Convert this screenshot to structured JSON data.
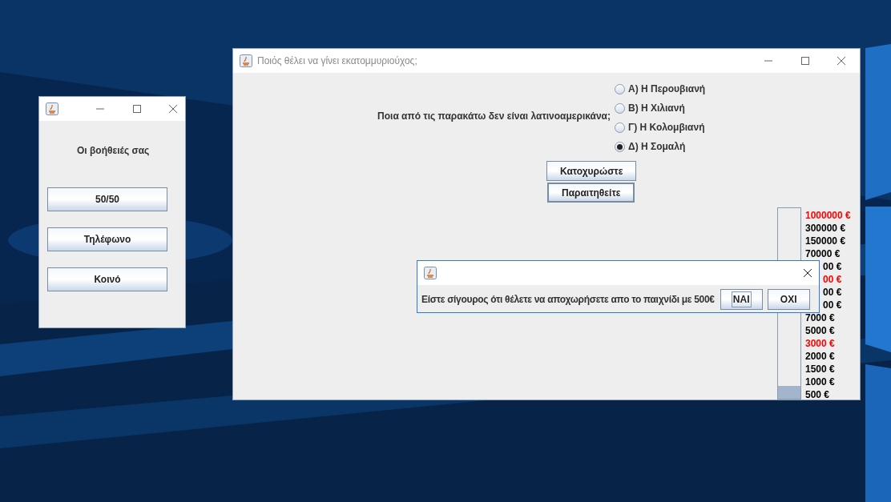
{
  "helpers_window": {
    "heading": "Οι βοήθειές σας",
    "buttons": [
      "50/50",
      "Τηλέφωνο",
      "Κοινό"
    ]
  },
  "main_window": {
    "title": "Ποιός θέλει να γίνει εκατομμυριούχος;",
    "question": "Ποια από τις παρακάτω δεν είναι λατινοαμερικάνα;",
    "answers": [
      {
        "label": "Α) Η Περουβιανή",
        "selected": false
      },
      {
        "label": "Β) Η Χιλιανή",
        "selected": false
      },
      {
        "label": "Γ) Η Κολομβιανή",
        "selected": false
      },
      {
        "label": "Δ) Η Σομαλή",
        "selected": true
      }
    ],
    "buttons": [
      "Κατοχυρώστε",
      "Παραιτηθείτε"
    ],
    "prize_ladder": {
      "level": 0.067,
      "prizes": [
        {
          "text": "1000000 €",
          "kind": "full",
          "color": "#ff0000"
        },
        {
          "text": "300000 €",
          "kind": "full",
          "color": "#000000"
        },
        {
          "text": "150000 €",
          "kind": "full",
          "color": "#000000"
        },
        {
          "text": "70000 €",
          "kind": "full",
          "color": "#000000"
        },
        {
          "text": "00 €",
          "kind": "cut",
          "color": "#000000"
        },
        {
          "text": "00 €",
          "kind": "cut",
          "color": "#ff0000"
        },
        {
          "text": "00 €",
          "kind": "cut",
          "color": "#000000"
        },
        {
          "text": "00 €",
          "kind": "cut",
          "color": "#000000"
        },
        {
          "text": "7000 €",
          "kind": "full",
          "color": "#000000"
        },
        {
          "text": "5000 €",
          "kind": "full",
          "color": "#000000"
        },
        {
          "text": "3000 €",
          "kind": "full",
          "color": "#ff0000"
        },
        {
          "text": "2000 €",
          "kind": "full",
          "color": "#000000"
        },
        {
          "text": "1500 €",
          "kind": "full",
          "color": "#000000"
        },
        {
          "text": "1000 €",
          "kind": "full",
          "color": "#000000"
        },
        {
          "text": "500 €",
          "kind": "full",
          "color": "#000000"
        }
      ]
    }
  },
  "dialog": {
    "message": "Είστε σίγουρος ότι θέλετε να αποχωρήσετε απο το παιχνίδι με 500€",
    "buttons": [
      {
        "label": "ΝΑΙ",
        "focused": true
      },
      {
        "label": "ΟΧΙ",
        "focused": false
      }
    ]
  }
}
